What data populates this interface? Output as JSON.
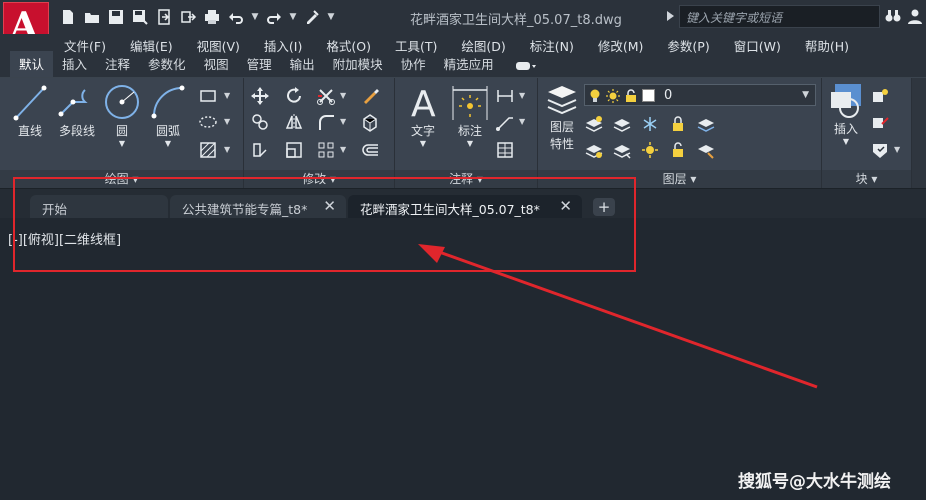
{
  "app": {
    "logo_letter": "A",
    "document_title": "花畔酒家卫生间大样_05.07_t8.dwg",
    "search_placeholder": "键入关键字或短语"
  },
  "quick_access": {
    "icons": [
      "new-file-icon",
      "open-folder-icon",
      "save-icon",
      "save-as-icon",
      "share-icon",
      "import-icon",
      "plot-icon",
      "undo-icon",
      "redo-icon",
      "match-properties-icon"
    ]
  },
  "menu": [
    "文件(F)",
    "编辑(E)",
    "视图(V)",
    "插入(I)",
    "格式(O)",
    "工具(T)",
    "绘图(D)",
    "标注(N)",
    "修改(M)",
    "参数(P)",
    "窗口(W)",
    "帮助(H)"
  ],
  "ribbon_tabs": [
    "默认",
    "插入",
    "注释",
    "参数化",
    "视图",
    "管理",
    "输出",
    "附加模块",
    "协作",
    "精选应用"
  ],
  "ribbon": {
    "draw": {
      "label": "绘图",
      "line": "直线",
      "polyline": "多段线",
      "circle": "圆",
      "arc": "圆弧"
    },
    "modify": {
      "label": "修改"
    },
    "annotation": {
      "label": "注释",
      "text": "文字",
      "dimension": "标注"
    },
    "layers": {
      "label": "图层",
      "layer_properties_line1": "图层",
      "layer_properties_line2": "特性",
      "current_layer": "0"
    },
    "block": {
      "label": "块",
      "insert": "插入"
    }
  },
  "file_tabs": {
    "start": "开始",
    "tab1": "公共建筑节能专篇_t8*",
    "tab2": "花畔酒家卫生间大样_05.07_t8*",
    "close_glyph": "✕",
    "add_glyph": "+"
  },
  "viewport_label": "[-][俯视][二维线框]",
  "watermark": "搜狐号@大水牛测绘",
  "colors": {
    "annotation_red": "#e0262c",
    "logo_red": "#c8102e",
    "background": "#212830"
  }
}
